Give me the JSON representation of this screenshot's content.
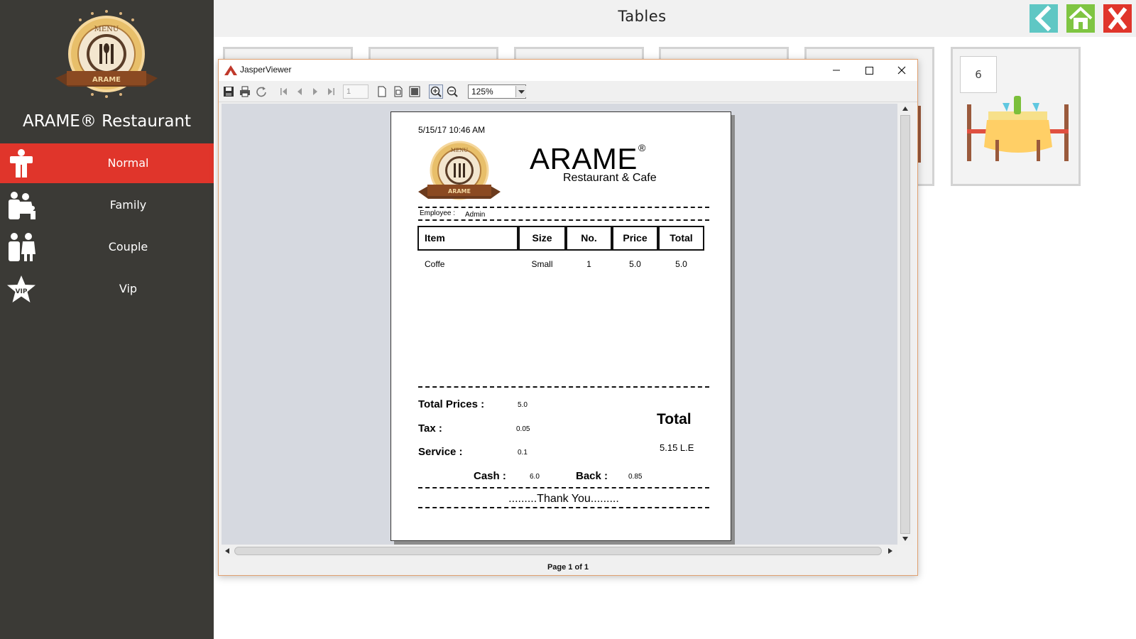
{
  "app": {
    "brand": "ARAME® Restaurant",
    "page_title": "Tables"
  },
  "sidebar": {
    "items": [
      {
        "label": "Normal",
        "icon": "person-icon",
        "active": true
      },
      {
        "label": "Family",
        "icon": "family-icon",
        "active": false
      },
      {
        "label": "Couple",
        "icon": "couple-icon",
        "active": false
      },
      {
        "label": "Vip",
        "icon": "vip-star-icon",
        "active": false
      }
    ]
  },
  "logo": {
    "top_text": "MENU",
    "banner_text": "ARAME"
  },
  "top_buttons": [
    {
      "name": "back",
      "icon": "back-arrow-icon",
      "color": "#5fc7c4"
    },
    {
      "name": "home",
      "icon": "home-icon",
      "color": "#7fc542"
    },
    {
      "name": "close",
      "icon": "close-x-icon",
      "color": "#e0352b"
    }
  ],
  "tables": {
    "visible_number": "6"
  },
  "viewer": {
    "window_title": "JasperViewer",
    "page_number": "1",
    "zoom": "125%",
    "status": "Page 1 of 1"
  },
  "receipt": {
    "datetime": "5/15/17 10:46 AM",
    "brand": "ARAME",
    "registered": "®",
    "subtitle": "Restaurant & Cafe",
    "employee_label": "Employee :",
    "employee_value": "Admin",
    "headers": [
      "Item",
      "Size",
      "No.",
      "Price",
      "Total"
    ],
    "rows": [
      {
        "item": "Coffe",
        "size": "Small",
        "no": "1",
        "price": "5.0",
        "total": "5.0"
      }
    ],
    "total_prices_label": "Total Prices :",
    "total_prices_value": "5.0",
    "tax_label": "Tax :",
    "tax_value": "0.05",
    "service_label": "Service :",
    "service_value": "0.1",
    "cash_label": "Cash :",
    "cash_value": "6.0",
    "back_label": "Back :",
    "back_value": "0.85",
    "total_label": "Total",
    "total_value": "5.15 L.E",
    "thanks": ".........Thank You........."
  },
  "colors": {
    "sidebar_bg": "#3b3a36",
    "active_red": "#e0352b",
    "back_teal": "#5fc7c4",
    "home_green": "#7fc542"
  }
}
